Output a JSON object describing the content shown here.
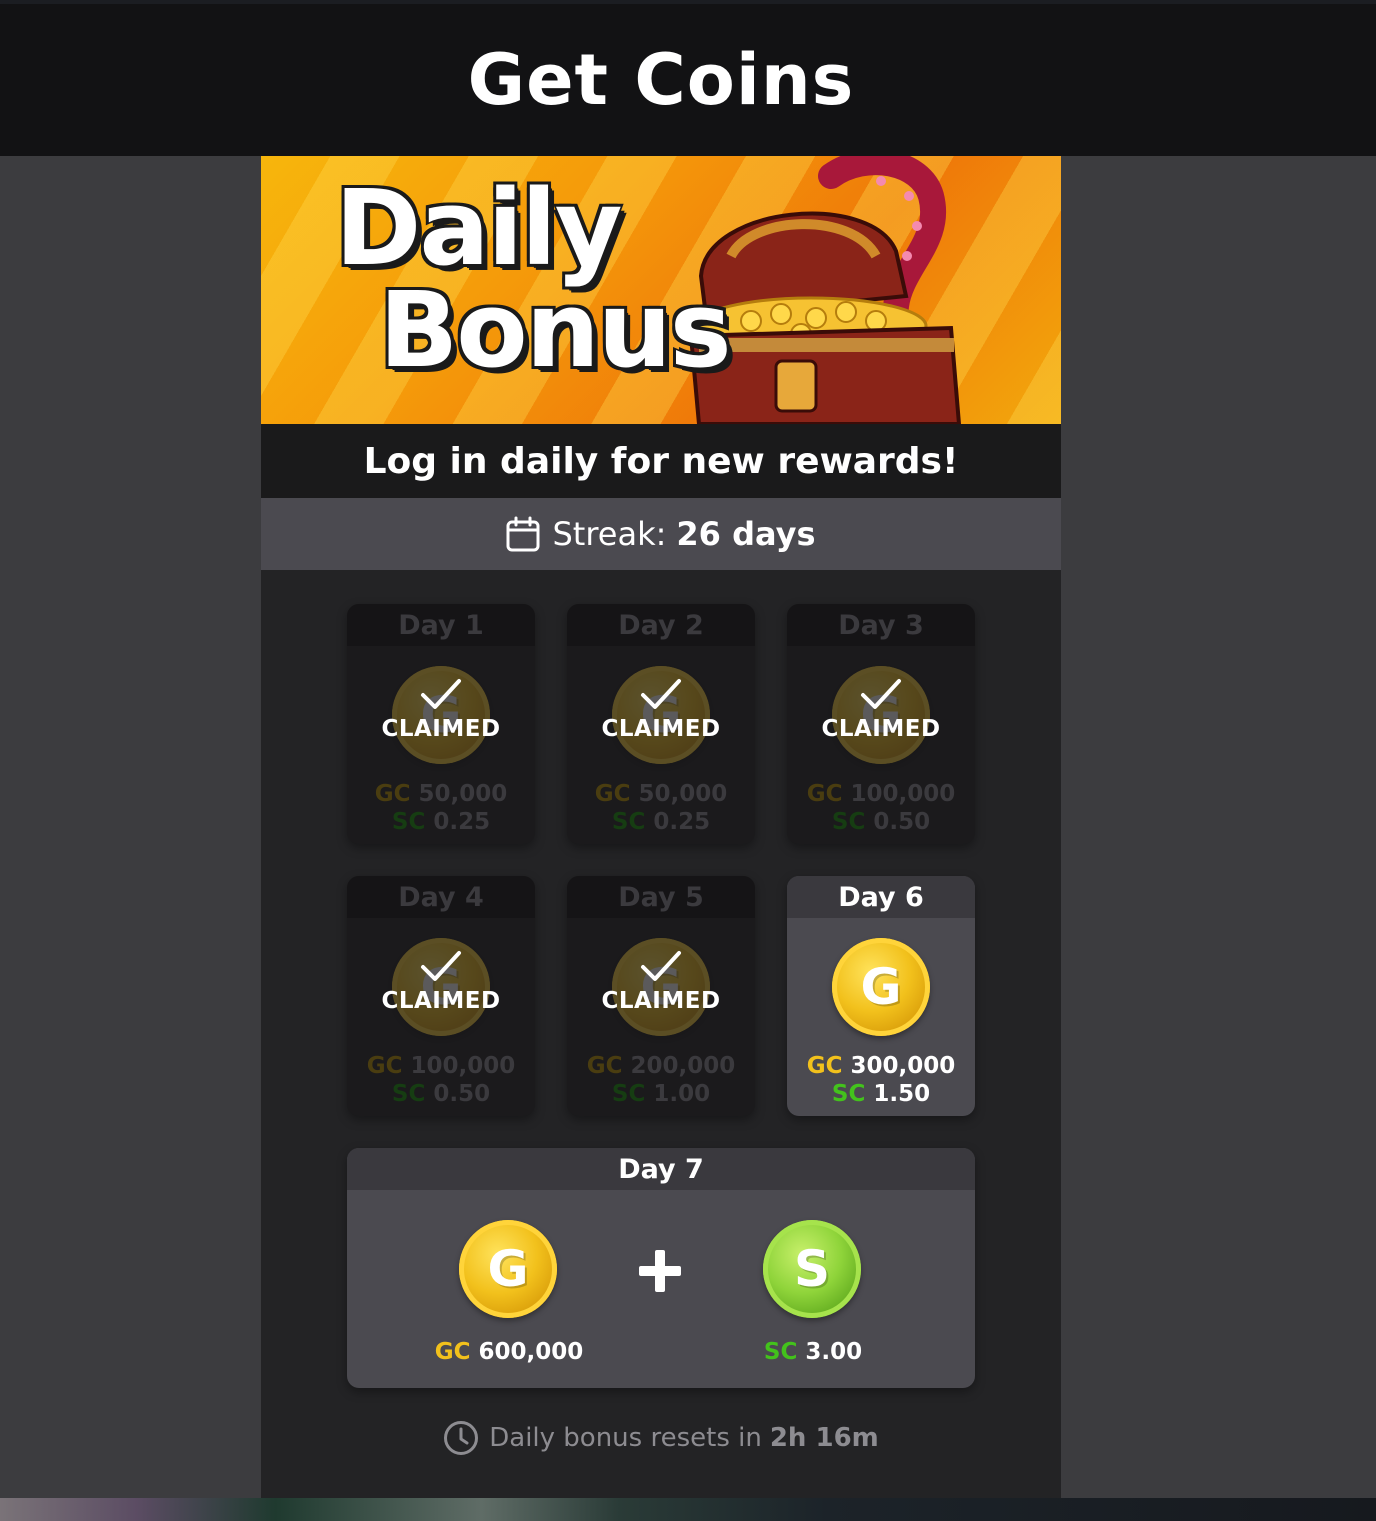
{
  "header": {
    "title": "Get Coins"
  },
  "banner": {
    "line1": "Daily",
    "line2": "Bonus"
  },
  "subtitle": "Log in daily for new rewards!",
  "streak": {
    "label": "Streak:",
    "value": "26 days"
  },
  "claimed_label": "CLAIMED",
  "currency": {
    "gc": "GC",
    "sc": "SC",
    "gc_symbol": "G",
    "sc_symbol": "S"
  },
  "days": [
    {
      "label": "Day 1",
      "gc": "50,000",
      "sc": "0.25",
      "status": "claimed"
    },
    {
      "label": "Day 2",
      "gc": "50,000",
      "sc": "0.25",
      "status": "claimed"
    },
    {
      "label": "Day 3",
      "gc": "100,000",
      "sc": "0.50",
      "status": "claimed"
    },
    {
      "label": "Day 4",
      "gc": "100,000",
      "sc": "0.50",
      "status": "claimed"
    },
    {
      "label": "Day 5",
      "gc": "200,000",
      "sc": "1.00",
      "status": "claimed"
    },
    {
      "label": "Day 6",
      "gc": "300,000",
      "sc": "1.50",
      "status": "available"
    }
  ],
  "day7": {
    "label": "Day 7",
    "gc": "600,000",
    "sc": "3.00",
    "plus": "+"
  },
  "reset": {
    "label": "Daily bonus resets in",
    "value": "2h 16m"
  },
  "colors": {
    "gc": "#f2c11c",
    "sc": "#43c21c",
    "panel": "#232325",
    "header": "#121214"
  }
}
